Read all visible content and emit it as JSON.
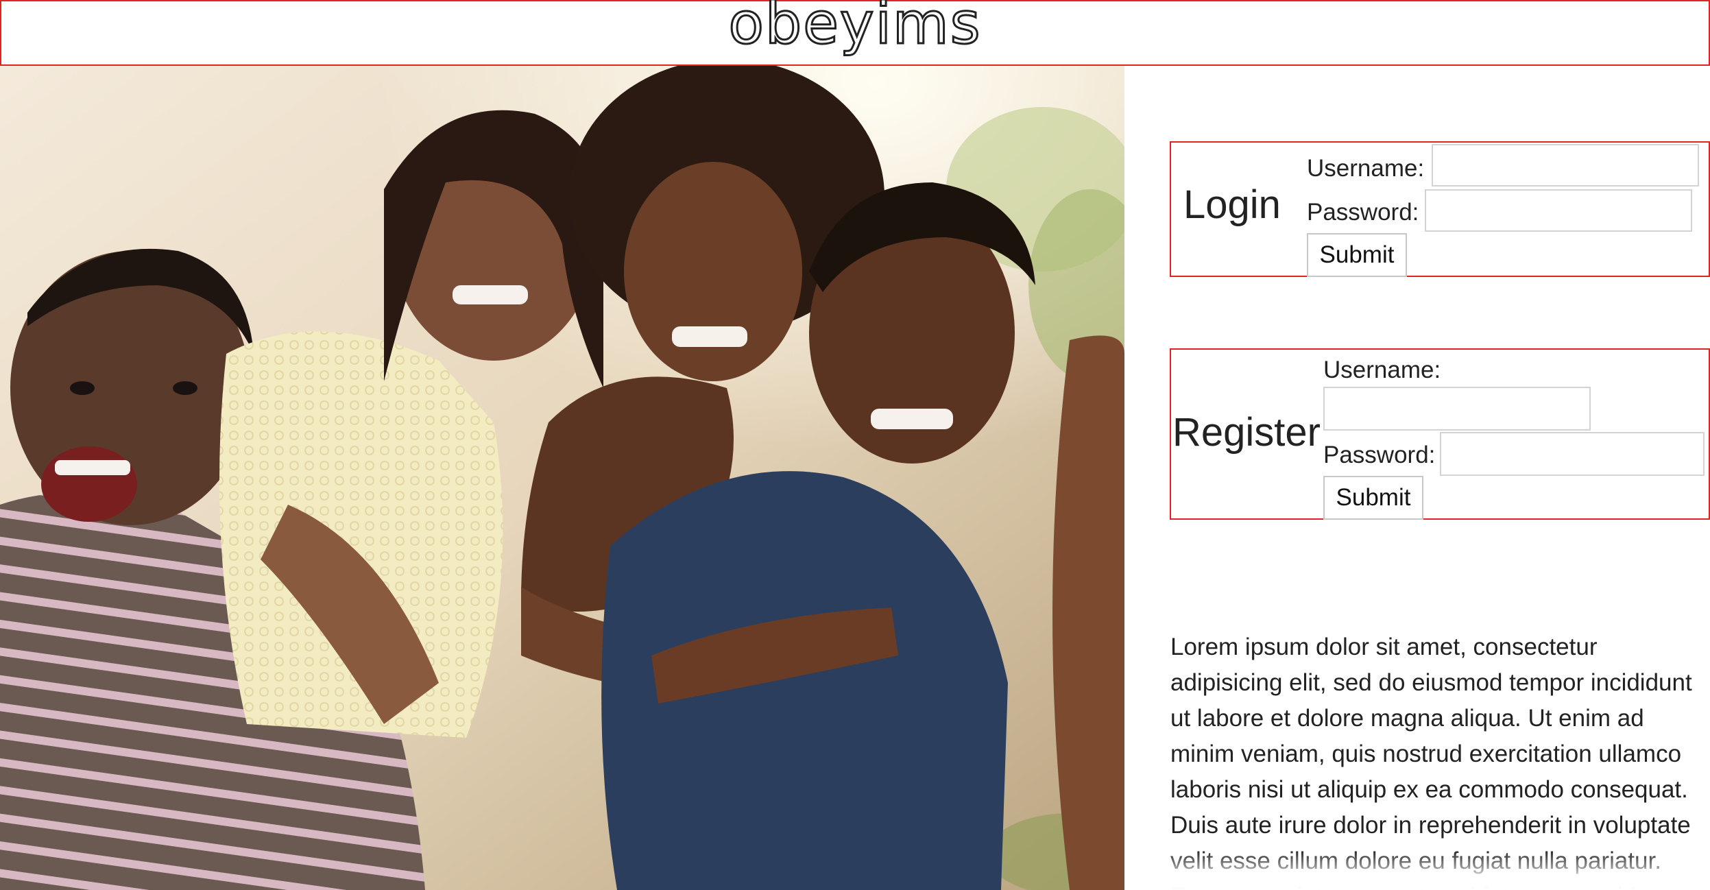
{
  "header": {
    "logo_text": "obeyims"
  },
  "hero": {
    "image_alt": "Group of four smiling friends hugging outdoors"
  },
  "login": {
    "title": "Login",
    "username_label": "Username:",
    "username_value": "",
    "password_label": "Password:",
    "password_value": "",
    "submit_label": "Submit"
  },
  "register": {
    "title": "Register",
    "username_label": "Username:",
    "username_value": "",
    "password_label": "Password:",
    "password_value": "",
    "submit_label": "Submit"
  },
  "body_text": "Lorem ipsum dolor sit amet, consectetur adipisicing elit, sed do eiusmod tempor incididunt ut labore et dolore magna aliqua. Ut enim ad minim veniam, quis nostrud exercitation ullamco laboris nisi ut aliquip ex ea commodo consequat. Duis aute irure dolor in reprehenderit in voluptate velit esse cillum dolore eu fugiat nulla pariatur. Excepteur sint occaecat cupidatat non proident,",
  "colors": {
    "border_accent": "#e02424",
    "text": "#222222",
    "background": "#ffffff"
  }
}
